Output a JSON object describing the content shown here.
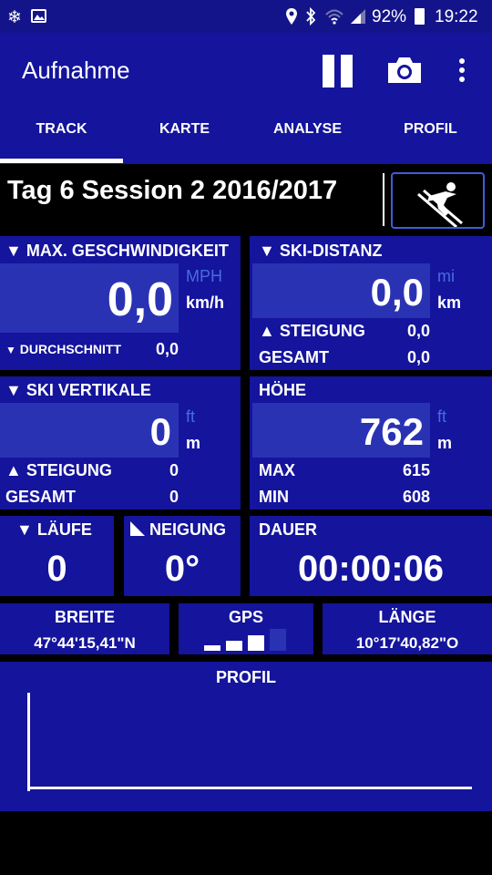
{
  "status_bar": {
    "battery": "92%",
    "time": "19:22"
  },
  "app_bar": {
    "title": "Aufnahme",
    "actions": [
      "pause-icon",
      "camera-icon",
      "more-vert-icon"
    ]
  },
  "tabs": [
    {
      "label": "TRACK",
      "active": true
    },
    {
      "label": "KARTE",
      "active": false
    },
    {
      "label": "ANALYSE",
      "active": false
    },
    {
      "label": "PROFIL",
      "active": false
    }
  ],
  "session": {
    "title": "Tag 6 Session 2 2016/2017",
    "activity_icon": "skier-icon"
  },
  "speed": {
    "label": "MAX. GESCHWINDIGKEIT",
    "value": "0,0",
    "unit_alt": "MPH",
    "unit": "km/h",
    "avg_label": "DURCHSCHNITT",
    "avg_value": "0,0"
  },
  "distance": {
    "label": "SKI-DISTANZ",
    "value": "0,0",
    "unit_alt": "mi",
    "unit": "km",
    "climb_label": "STEIGUNG",
    "climb_value": "0,0",
    "total_label": "GESAMT",
    "total_value": "0,0"
  },
  "vertical": {
    "label": "SKI VERTIKALE",
    "value": "0",
    "unit_alt": "ft",
    "unit": "m",
    "climb_label": "STEIGUNG",
    "climb_value": "0",
    "total_label": "GESAMT",
    "total_value": "0"
  },
  "altitude": {
    "label": "HÖHE",
    "value": "762",
    "unit_alt": "ft",
    "unit": "m",
    "max_label": "MAX",
    "max_value": "615",
    "min_label": "MIN",
    "min_value": "608"
  },
  "runs": {
    "label": "LÄUFE",
    "value": "0"
  },
  "slope": {
    "label": "NEIGUNG",
    "value": "0°"
  },
  "duration": {
    "label": "DAUER",
    "value": "00:00:06"
  },
  "latitude": {
    "label": "BREITE",
    "value": "47°44'15,41\"N"
  },
  "gps": {
    "label": "GPS",
    "signal_bars_filled": 3,
    "signal_bars_total": 4
  },
  "longitude": {
    "label": "LÄNGE",
    "value": "10°17'40,82\"O"
  },
  "profile": {
    "label": "PROFIL"
  },
  "colors": {
    "panel_bg": "#14149c",
    "value_box": "#2a32b4",
    "dim_unit": "#4a6bdd",
    "status_bar": "#14148a"
  }
}
